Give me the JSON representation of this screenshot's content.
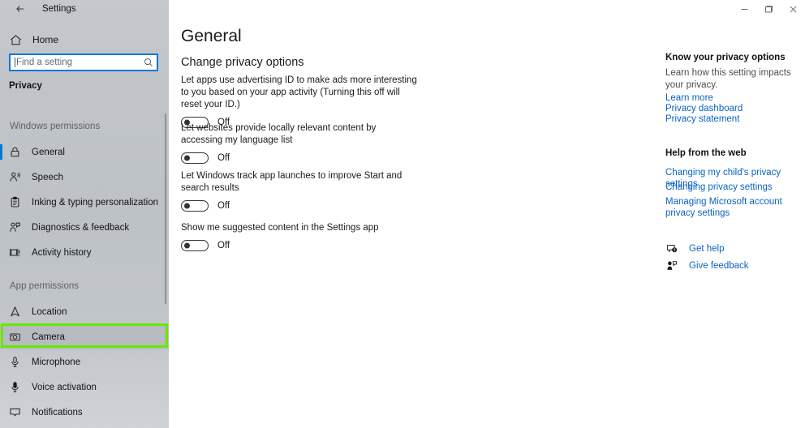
{
  "titlebar": {
    "back_icon": "back-arrow-icon",
    "title": "Settings",
    "minimize_label": "Minimize",
    "maximize_label": "Restore",
    "close_label": "Close"
  },
  "sidebar": {
    "home": {
      "label": "Home",
      "icon": "home-icon"
    },
    "search": {
      "placeholder": "Find a setting",
      "value": "",
      "icon": "search-icon"
    },
    "page_title": "Privacy",
    "groups": [
      {
        "title": "Windows permissions",
        "items": [
          {
            "label": "General",
            "icon": "lock-icon",
            "selected": true
          },
          {
            "label": "Speech",
            "icon": "speech-person-icon",
            "selected": false
          },
          {
            "label": "Inking & typing personalization",
            "icon": "clipboard-pen-icon",
            "selected": false
          },
          {
            "label": "Diagnostics & feedback",
            "icon": "feedback-person-icon",
            "selected": false
          },
          {
            "label": "Activity history",
            "icon": "activity-history-icon",
            "selected": false
          }
        ]
      },
      {
        "title": "App permissions",
        "items": [
          {
            "label": "Location",
            "icon": "location-pin-icon",
            "selected": false
          },
          {
            "label": "Camera",
            "icon": "camera-icon",
            "selected": false,
            "highlighted": true
          },
          {
            "label": "Microphone",
            "icon": "microphone-icon",
            "selected": false
          },
          {
            "label": "Voice activation",
            "icon": "voice-activation-icon",
            "selected": false
          },
          {
            "label": "Notifications",
            "icon": "notification-icon",
            "selected": false
          }
        ]
      }
    ]
  },
  "main": {
    "page_title": "General",
    "section_title": "Change privacy options",
    "settings": [
      {
        "description": "Let apps use advertising ID to make ads more interesting to you based on your app activity (Turning this off will reset your ID.)",
        "state": "Off"
      },
      {
        "description": "Let websites provide locally relevant content by accessing my language list",
        "state": "Off"
      },
      {
        "description": "Let Windows track app launches to improve Start and search results",
        "state": "Off"
      },
      {
        "description": "Show me suggested content in the Settings app",
        "state": "Off"
      }
    ]
  },
  "right_panel": {
    "privacy_heading": "Know your privacy options",
    "privacy_subtext": "Learn how this setting impacts your privacy.",
    "privacy_links": [
      "Learn more",
      "Privacy dashboard",
      "Privacy statement"
    ],
    "help_heading": "Help from the web",
    "help_links": [
      "Changing my child's privacy settings",
      "Changing privacy settings",
      "Managing Microsoft account privacy settings"
    ],
    "actions": [
      {
        "label": "Get help",
        "icon": "help-bubble-icon"
      },
      {
        "label": "Give feedback",
        "icon": "feedback-person-icon"
      }
    ]
  },
  "colors": {
    "accent": "#0078d7",
    "link": "#0a64c2",
    "highlight_box": "#6ae800",
    "sidebar_top": "#c5c9cd",
    "sidebar_bottom": "#cfd3d7"
  }
}
